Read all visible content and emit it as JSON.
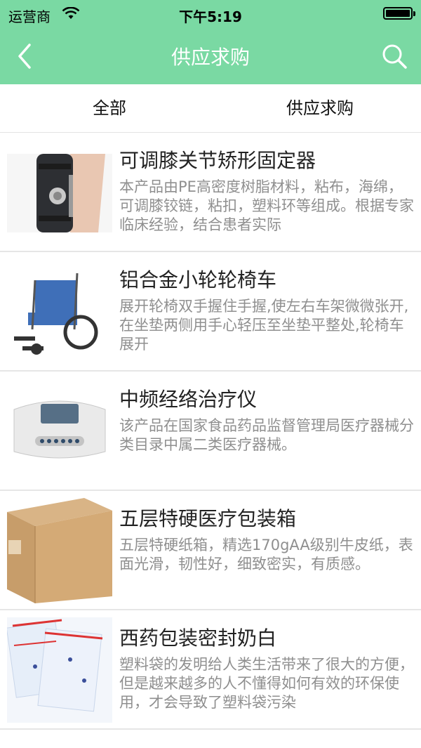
{
  "status": {
    "carrier": "运营商",
    "time": "下午5:19"
  },
  "navbar": {
    "title": "供应求购",
    "back_icon": "chevron-left-icon",
    "search_icon": "search-icon"
  },
  "tabs": [
    "全部",
    "供应求购"
  ],
  "colors": {
    "accent": "#7ad9a3",
    "title_text": "#222222",
    "desc_text": "#8f8f8f"
  },
  "items": [
    {
      "name": "可调膝关节矫形固定器",
      "desc": "本产品由PE高密度树脂材料，粘布，海绵，可调膝铰链，粘扣，塑料环等组成。根据专家临床经验，结合患者实际",
      "image": "knee-brace-image"
    },
    {
      "name": "铝合金小轮轮椅车",
      "desc": "展开轮椅双手握住手握,使左右车架微微张开,在坐垫两侧用手心轻压至坐垫平整处,轮椅车展开",
      "image": "wheelchair-image"
    },
    {
      "name": "中频经络治疗仪",
      "desc": "该产品在国家食品药品监督管理局医疗器械分类目录中属二类医疗器械。",
      "image": "therapy-device-image"
    },
    {
      "name": "五层特硬医疗包装箱",
      "desc": "五层特硬纸箱，精选170gAA级别牛皮纸，表面光滑，韧性好，细致密实，有质感。",
      "image": "cardboard-box-image"
    },
    {
      "name": "西药包装密封奶白",
      "desc": "塑料袋的发明给人类生活带来了很大的方便，但是越来越多的人不懂得如何有效的环保使用，才会导致了塑料袋污染",
      "image": "sealed-bags-image"
    }
  ]
}
